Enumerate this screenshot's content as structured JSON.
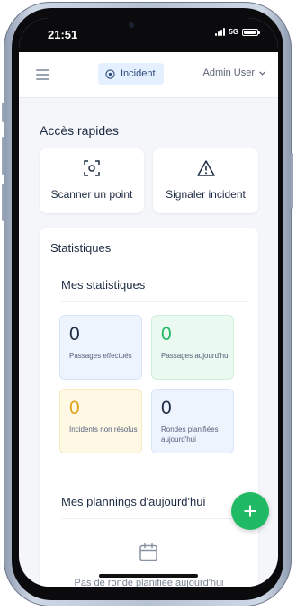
{
  "status_bar": {
    "time": "21:51",
    "network": "5G"
  },
  "header": {
    "incident_label": "Incident",
    "user_name": "Admin User"
  },
  "quick_access": {
    "title": "Accès rapides",
    "items": [
      {
        "label": "Scanner un point",
        "icon": "scan-icon"
      },
      {
        "label": "Signaler incident",
        "icon": "warning-icon"
      }
    ]
  },
  "statistics": {
    "title": "Statistiques",
    "my_stats_title": "Mes statistiques",
    "tiles": [
      {
        "value": "0",
        "label": "Passages effectués",
        "color": "#1d2b43"
      },
      {
        "value": "0",
        "label": "Passages aujourd'hui",
        "color": "#1fba63"
      },
      {
        "value": "0",
        "label": "Incidents non résolus",
        "color": "#e0a21a"
      },
      {
        "value": "0",
        "label": "Rondes planifiées aujourd'hui",
        "color": "#1d2b43"
      }
    ],
    "plannings_title": "Mes plannings d'aujourd'hui",
    "plannings_empty": "Pas de ronde planifiée aujourd'hui"
  },
  "colors": {
    "accent_green": "#1fba63",
    "brand_blue": "#e4efff"
  }
}
